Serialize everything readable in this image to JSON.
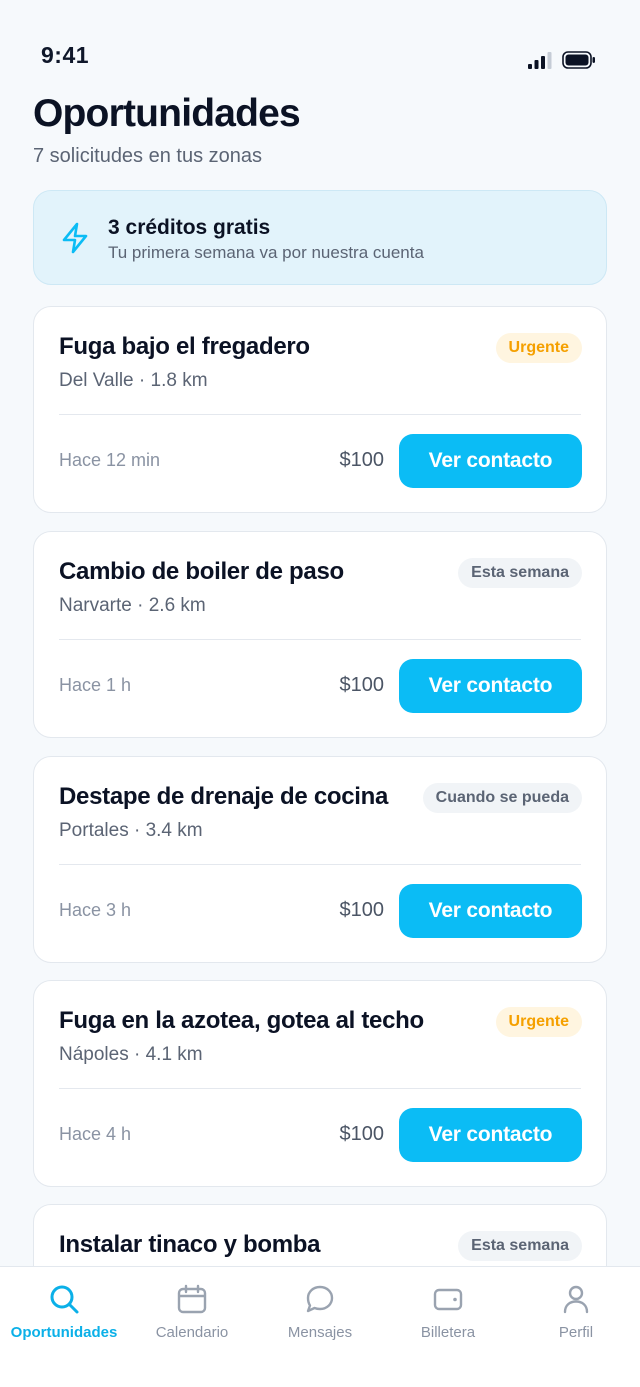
{
  "status_bar": {
    "time": "9:41"
  },
  "header": {
    "title": "Oportunidades",
    "subtitle": "7 solicitudes en tus zonas"
  },
  "promo": {
    "icon": "lightning-icon",
    "title": "3 créditos gratis",
    "subtitle": "Tu primera semana va por nuestra cuenta"
  },
  "cards": [
    {
      "title": "Fuga bajo el fregadero",
      "meta": "Del Valle · 1.8 km",
      "badge": "Urgente",
      "badge_type": "urgent",
      "time": "Hace 12 min",
      "price": "$100",
      "button": "Ver contacto"
    },
    {
      "title": "Cambio de boiler de paso",
      "meta": "Narvarte · 2.6 km",
      "badge": "Esta semana",
      "badge_type": "week",
      "time": "Hace 1 h",
      "price": "$100",
      "button": "Ver contacto"
    },
    {
      "title": "Destape de drenaje de cocina",
      "meta": "Portales · 3.4 km",
      "badge": "Cuando se pueda",
      "badge_type": "whenever",
      "time": "Hace 3 h",
      "price": "$100",
      "button": "Ver contacto"
    },
    {
      "title": "Fuga en la azotea, gotea al techo",
      "meta": "Nápoles · 4.1 km",
      "badge": "Urgente",
      "badge_type": "urgent",
      "time": "Hace 4 h",
      "price": "$100",
      "button": "Ver contacto"
    },
    {
      "title": "Instalar tinaco y bomba",
      "meta": "",
      "badge": "Esta semana",
      "badge_type": "week",
      "time": "",
      "price": "",
      "button": ""
    }
  ],
  "tabbar": {
    "items": [
      {
        "label": "Oportunidades",
        "icon": "search-icon",
        "active": true
      },
      {
        "label": "Calendario",
        "icon": "calendar-icon",
        "active": false
      },
      {
        "label": "Mensajes",
        "icon": "chat-icon",
        "active": false
      },
      {
        "label": "Billetera",
        "icon": "wallet-icon",
        "active": false
      },
      {
        "label": "Perfil",
        "icon": "user-icon",
        "active": false
      }
    ]
  },
  "colors": {
    "accent": "#0bbcf5",
    "urgent": "#f5a000",
    "promo_bg": "#e2f3fb"
  }
}
